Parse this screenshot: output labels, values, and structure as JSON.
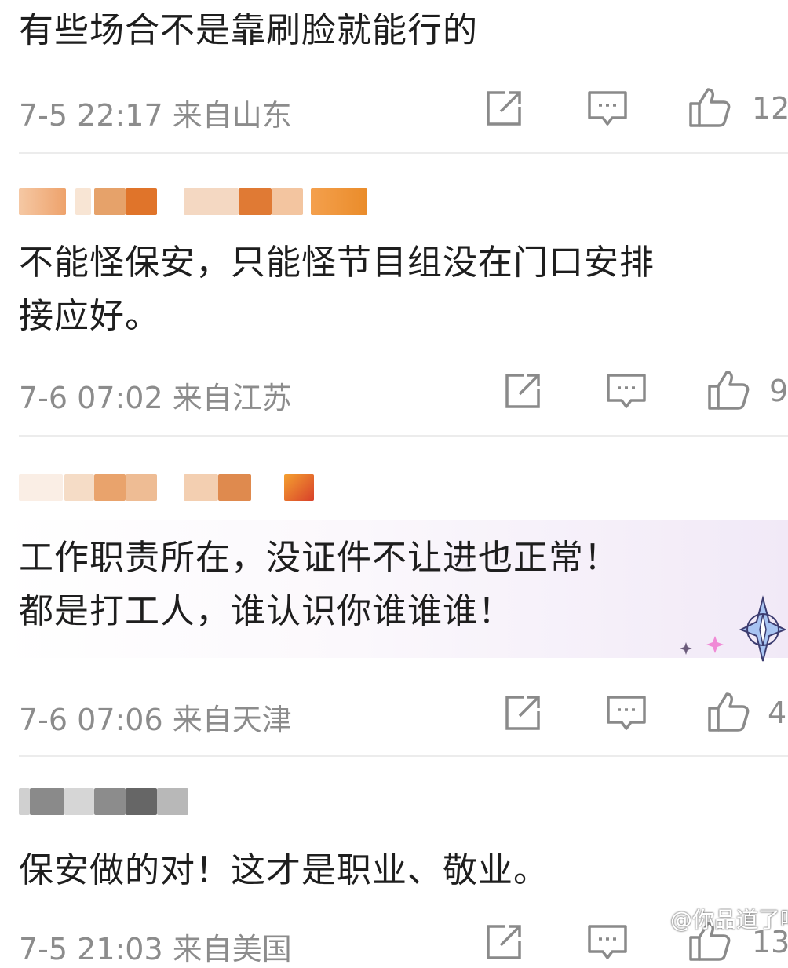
{
  "comments": [
    {
      "text_lines": [
        "有些场合不是靠刷脸就能行的"
      ],
      "meta": "7-5 22:17  来自山东",
      "likes": "12"
    },
    {
      "text_lines": [
        "不能怪保安，只能怪节目组没在门口安排",
        "接应好。"
      ],
      "meta": "7-6 07:02  来自江苏",
      "likes": "9"
    },
    {
      "text_lines": [
        "工作职责所在，没证件不让进也正常！",
        "都是打工人，谁认识你谁谁谁！"
      ],
      "meta": "7-6 07:06  来自天津",
      "likes": "4"
    },
    {
      "text_lines": [
        "保安做的对！这才是职业、敬业。"
      ],
      "meta": "7-5 21:03  来自美国",
      "likes": "13"
    }
  ],
  "icons": {
    "forward": "share-square-icon",
    "comment": "comment-bubble-icon",
    "like": "thumbs-up-icon"
  },
  "watermark": "@你品道了吗",
  "colors": {
    "meta_gray": "#8c8c8c",
    "divider": "#ececec",
    "blur_orange": "#e8823a",
    "blur_gray": "#8a8a8a"
  }
}
